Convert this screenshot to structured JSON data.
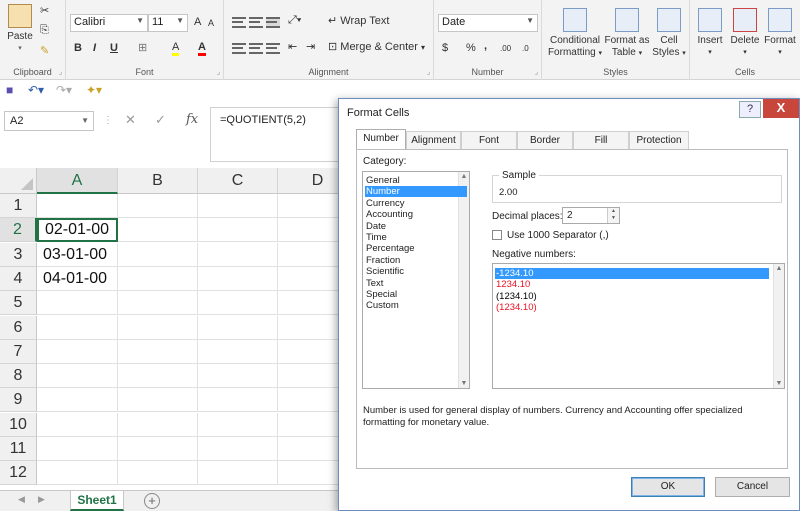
{
  "ribbon": {
    "clipboard": {
      "paste": "Paste",
      "group": "Clipboard"
    },
    "font": {
      "name": "Calibri",
      "size": "11",
      "bold": "B",
      "italic": "I",
      "underline": "U",
      "grow": "A",
      "shrink": "A",
      "fill": "A",
      "color": "A",
      "group": "Font"
    },
    "alignment": {
      "wrap": "Wrap Text",
      "merge": "Merge & Center",
      "group": "Alignment"
    },
    "number": {
      "format": "Date",
      "currency": "$",
      "percent": "%",
      "comma": ",",
      "group": "Number",
      "increase_decimal": ".00",
      "decrease_decimal": ".0"
    },
    "styles": {
      "conditional": "Conditional",
      "conditional2": "Formatting",
      "format_as": "Format as",
      "format_as2": "Table",
      "cell": "Cell",
      "cell2": "Styles",
      "group": "Styles"
    },
    "cells": {
      "insert": "Insert",
      "delete": "Delete",
      "format": "Format",
      "group": "Cells"
    }
  },
  "formula_bar": {
    "name_box": "A2",
    "fx": "fx",
    "formula": "=QUOTIENT(5,2)"
  },
  "grid": {
    "columns": [
      "A",
      "B",
      "C",
      "D"
    ],
    "rows": [
      "1",
      "2",
      "3",
      "4",
      "5",
      "6",
      "7",
      "8",
      "9",
      "10",
      "11",
      "12"
    ],
    "cells": {
      "A2": "02-01-00",
      "A3": "03-01-00",
      "A4": "04-01-00"
    }
  },
  "sheet_tabs": {
    "active": "Sheet1",
    "add": "+"
  },
  "dialog": {
    "title": "Format Cells",
    "help": "?",
    "close": "X",
    "tabs": [
      "Number",
      "Alignment",
      "Font",
      "Border",
      "Fill",
      "Protection"
    ],
    "category_label": "Category:",
    "categories": [
      "General",
      "Number",
      "Currency",
      "Accounting",
      "Date",
      "Time",
      "Percentage",
      "Fraction",
      "Scientific",
      "Text",
      "Special",
      "Custom"
    ],
    "selected_category": "Number",
    "sample_label": "Sample",
    "sample_value": "2.00",
    "decimal_label": "Decimal places:",
    "decimal_value": "2",
    "separator_label": "Use 1000 Separator (,)",
    "negative_label": "Negative numbers:",
    "negative_numbers": [
      {
        "text": "-1234.10",
        "color": "#000000",
        "selected": true
      },
      {
        "text": "1234.10",
        "color": "#e81123",
        "selected": false
      },
      {
        "text": "(1234.10)",
        "color": "#000000",
        "selected": false
      },
      {
        "text": "(1234.10)",
        "color": "#e81123",
        "selected": false
      }
    ],
    "description": "Number is used for general display of numbers.  Currency and Accounting offer specialized formatting for monetary value.",
    "ok": "OK",
    "cancel": "Cancel"
  },
  "colors": {
    "excel_green": "#217346",
    "selection_blue": "#3399ff",
    "negative_red": "#e81123"
  }
}
